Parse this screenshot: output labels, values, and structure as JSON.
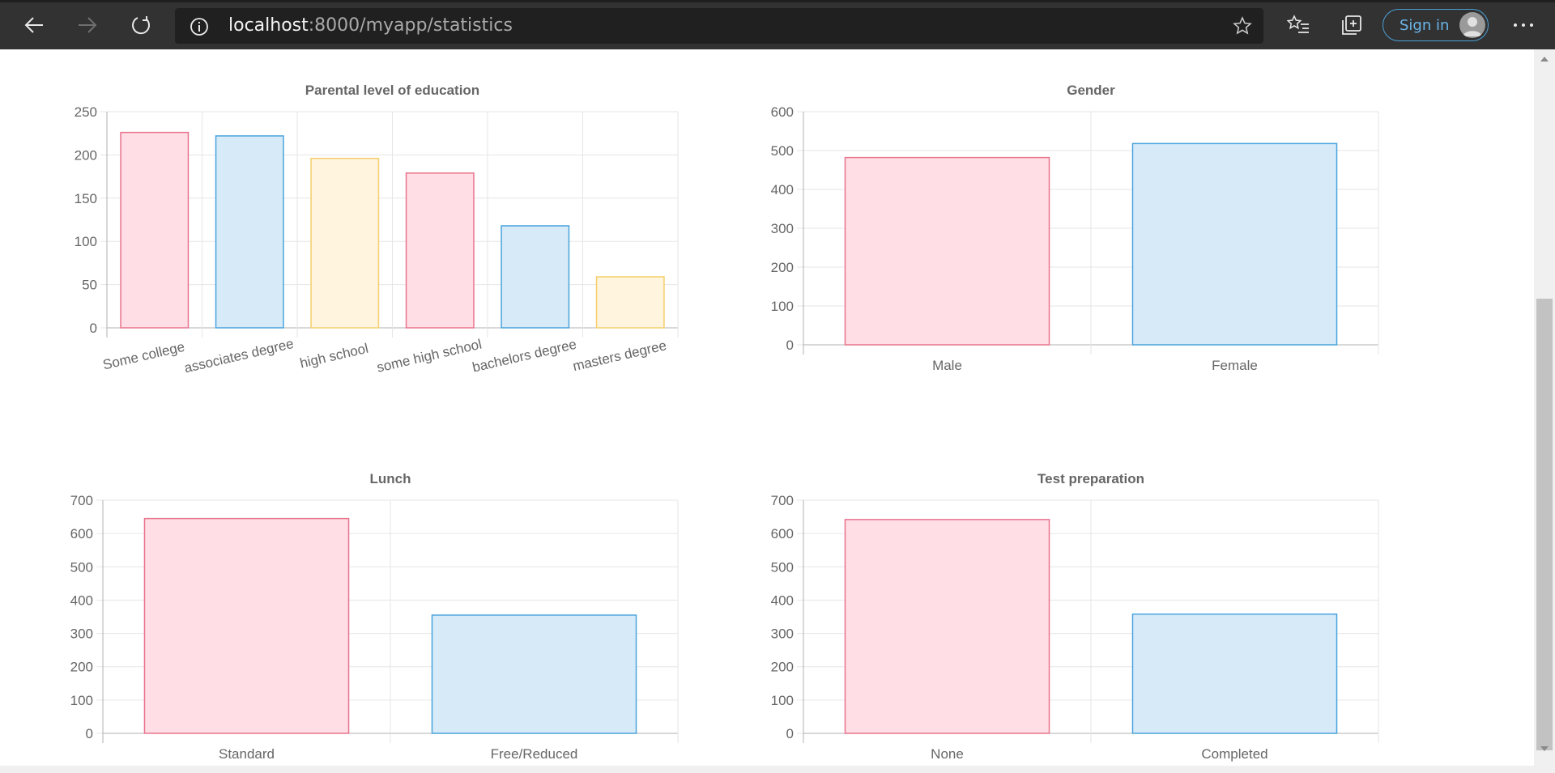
{
  "browser": {
    "url_host": "localhost",
    "url_rest": ":8000/myapp/statistics",
    "sign_in_label": "Sign in",
    "icons": [
      "back-arrow-icon",
      "forward-arrow-icon",
      "refresh-icon",
      "info-icon",
      "add-favorite-icon",
      "favorites-icon",
      "collections-icon",
      "user-avatar-icon",
      "more-icon"
    ]
  },
  "colors": {
    "pink_fill": "#ffdfe5",
    "pink_border": "#e8738d",
    "blue_fill": "#d6eaf8",
    "blue_border": "#4aa3dc",
    "yellow_fill": "#fff4dd",
    "yellow_border": "#f5cf6c",
    "grid": "#e6e6e6",
    "axis": "#b0b0b0"
  },
  "charts": [
    {
      "type": "bar",
      "title": "Parental level of education",
      "categories": [
        "Some college",
        "associates degree",
        "high school",
        "some high school",
        "bachelors degree",
        "masters degree"
      ],
      "values": [
        226,
        222,
        196,
        179,
        118,
        59
      ],
      "ylim": [
        0,
        250
      ],
      "yticks": [
        "0",
        "50",
        "100",
        "150",
        "200",
        "250"
      ],
      "bar_colors": [
        "pink",
        "blue",
        "yellow",
        "pink",
        "blue",
        "yellow"
      ],
      "rotated_labels": true
    },
    {
      "type": "bar",
      "title": "Gender",
      "categories": [
        "Male",
        "Female"
      ],
      "values": [
        482,
        518
      ],
      "ylim": [
        0,
        600
      ],
      "yticks": [
        "0",
        "100",
        "200",
        "300",
        "400",
        "500",
        "600"
      ],
      "bar_colors": [
        "pink",
        "blue"
      ],
      "rotated_labels": false
    },
    {
      "type": "bar",
      "title": "Lunch",
      "categories": [
        "Standard",
        "Free/Reduced"
      ],
      "values": [
        645,
        355
      ],
      "ylim": [
        0,
        700
      ],
      "yticks": [
        "0",
        "100",
        "200",
        "300",
        "400",
        "500",
        "600",
        "700"
      ],
      "bar_colors": [
        "pink",
        "blue"
      ],
      "rotated_labels": false
    },
    {
      "type": "bar",
      "title": "Test preparation",
      "categories": [
        "None",
        "Completed"
      ],
      "values": [
        642,
        358
      ],
      "ylim": [
        0,
        700
      ],
      "yticks": [
        "0",
        "100",
        "200",
        "300",
        "400",
        "500",
        "600",
        "700"
      ],
      "bar_colors": [
        "pink",
        "blue"
      ],
      "rotated_labels": false
    }
  ],
  "chart_data": [
    {
      "type": "bar",
      "title": "Parental level of education",
      "categories": [
        "Some college",
        "associates degree",
        "high school",
        "some high school",
        "bachelors degree",
        "masters degree"
      ],
      "values": [
        226,
        222,
        196,
        179,
        118,
        59
      ],
      "ylim": [
        0,
        250
      ],
      "grid": true
    },
    {
      "type": "bar",
      "title": "Gender",
      "categories": [
        "Male",
        "Female"
      ],
      "values": [
        482,
        518
      ],
      "ylim": [
        0,
        600
      ],
      "grid": true
    },
    {
      "type": "bar",
      "title": "Lunch",
      "categories": [
        "Standard",
        "Free/Reduced"
      ],
      "values": [
        645,
        355
      ],
      "ylim": [
        0,
        700
      ],
      "grid": true
    },
    {
      "type": "bar",
      "title": "Test preparation",
      "categories": [
        "None",
        "Completed"
      ],
      "values": [
        642,
        358
      ],
      "ylim": [
        0,
        700
      ],
      "grid": true
    }
  ]
}
